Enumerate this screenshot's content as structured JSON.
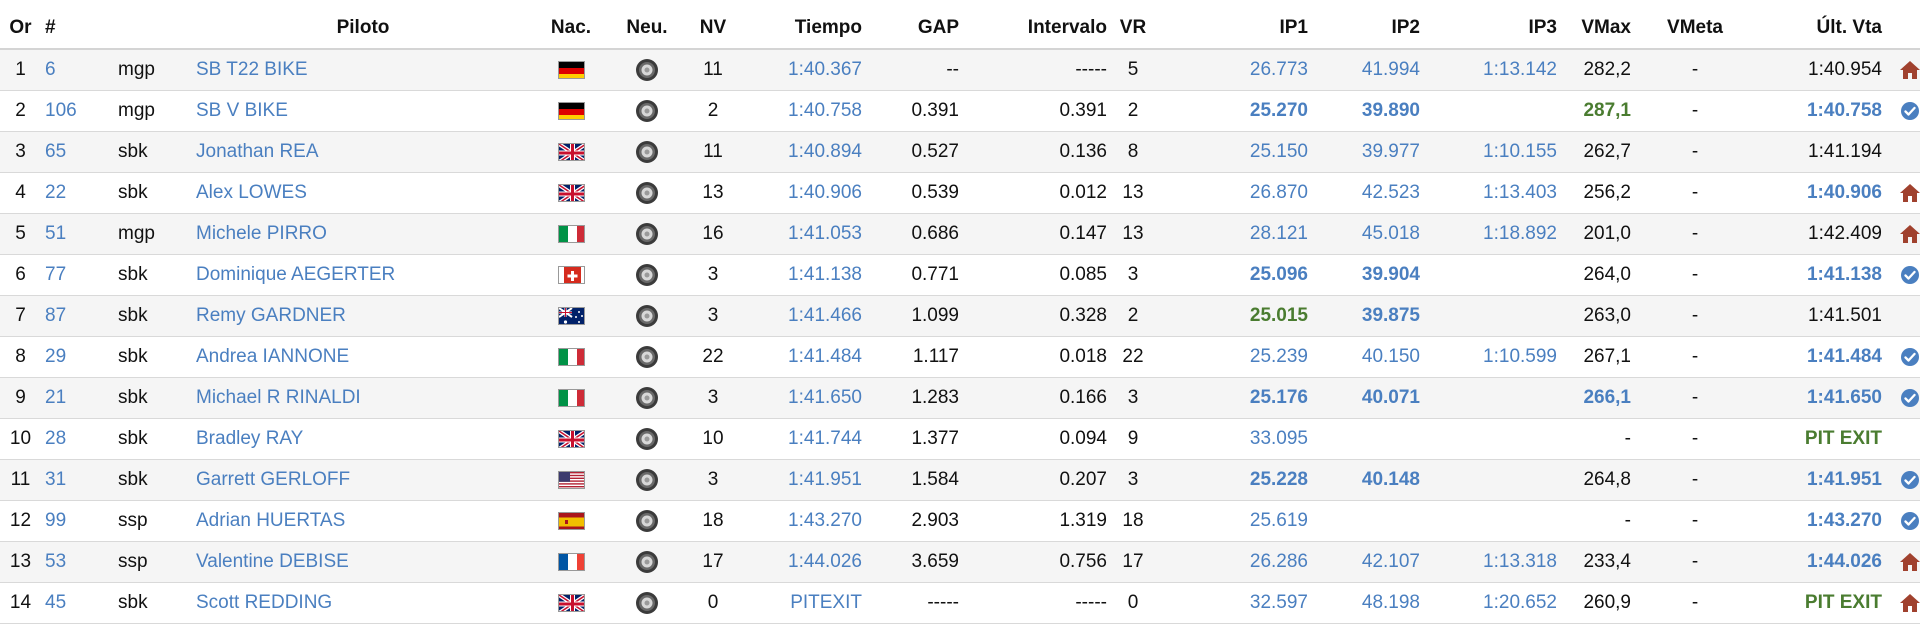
{
  "headers": {
    "or": "Or",
    "num": "#",
    "class": "",
    "pilot": "Piloto",
    "nac": "Nac.",
    "neu": "Neu.",
    "nv": "NV",
    "tiempo": "Tiempo",
    "gap": "GAP",
    "intervalo": "Intervalo",
    "vr": "VR",
    "ip1": "IP1",
    "ip2": "IP2",
    "ip3": "IP3",
    "vmax": "VMax",
    "vmeta": "VMeta",
    "ult": "Últ. Vta"
  },
  "colors": {
    "link": "#4a7fc0",
    "green": "#4a7c30",
    "home": "#a0412e",
    "check": "#4a7fc0"
  },
  "rows": [
    {
      "or": "1",
      "num": "6",
      "cls": "mgp",
      "pilot": "SB T22 BIKE",
      "flag": "de",
      "tyre": "tyre-icon",
      "nv": "11",
      "tiempo": "1:40.367",
      "gap": "--",
      "intervalo": "-----",
      "vr": "5",
      "ip1": "26.773",
      "ip2": "41.994",
      "ip3": "1:13.142",
      "vmax": "282,2",
      "vmeta": "-",
      "ult": "1:40.954",
      "status": "home-icon"
    },
    {
      "or": "2",
      "num": "106",
      "cls": "mgp",
      "pilot": "SB V BIKE",
      "flag": "de",
      "tyre": "tyre-icon",
      "nv": "2",
      "tiempo": "1:40.758",
      "gap": "0.391",
      "intervalo": "0.391",
      "vr": "2",
      "ip1": "25.270",
      "ip2": "39.890",
      "ip3": "",
      "vmax": "287,1",
      "vmeta": "-",
      "ult": "1:40.758",
      "status": "check-icon"
    },
    {
      "or": "3",
      "num": "65",
      "cls": "sbk",
      "pilot": "Jonathan REA",
      "flag": "gb",
      "tyre": "tyre-icon",
      "nv": "11",
      "tiempo": "1:40.894",
      "gap": "0.527",
      "intervalo": "0.136",
      "vr": "8",
      "ip1": "25.150",
      "ip2": "39.977",
      "ip3": "1:10.155",
      "vmax": "262,7",
      "vmeta": "-",
      "ult": "1:41.194",
      "status": ""
    },
    {
      "or": "4",
      "num": "22",
      "cls": "sbk",
      "pilot": "Alex LOWES",
      "flag": "gb",
      "tyre": "tyre-icon",
      "nv": "13",
      "tiempo": "1:40.906",
      "gap": "0.539",
      "intervalo": "0.012",
      "vr": "13",
      "ip1": "26.870",
      "ip2": "42.523",
      "ip3": "1:13.403",
      "vmax": "256,2",
      "vmeta": "-",
      "ult": "1:40.906",
      "status": "home-icon"
    },
    {
      "or": "5",
      "num": "51",
      "cls": "mgp",
      "pilot": "Michele PIRRO",
      "flag": "it",
      "tyre": "tyre-icon",
      "nv": "16",
      "tiempo": "1:41.053",
      "gap": "0.686",
      "intervalo": "0.147",
      "vr": "13",
      "ip1": "28.121",
      "ip2": "45.018",
      "ip3": "1:18.892",
      "vmax": "201,0",
      "vmeta": "-",
      "ult": "1:42.409",
      "status": "home-icon"
    },
    {
      "or": "6",
      "num": "77",
      "cls": "sbk",
      "pilot": "Dominique AEGERTER",
      "flag": "ch",
      "tyre": "tyre-icon",
      "nv": "3",
      "tiempo": "1:41.138",
      "gap": "0.771",
      "intervalo": "0.085",
      "vr": "3",
      "ip1": "25.096",
      "ip2": "39.904",
      "ip3": "",
      "vmax": "264,0",
      "vmeta": "-",
      "ult": "1:41.138",
      "status": "check-icon"
    },
    {
      "or": "7",
      "num": "87",
      "cls": "sbk",
      "pilot": "Remy GARDNER",
      "flag": "au",
      "tyre": "tyre-icon",
      "nv": "3",
      "tiempo": "1:41.466",
      "gap": "1.099",
      "intervalo": "0.328",
      "vr": "2",
      "ip1": "25.015",
      "ip2": "39.875",
      "ip3": "",
      "vmax": "263,0",
      "vmeta": "-",
      "ult": "1:41.501",
      "status": ""
    },
    {
      "or": "8",
      "num": "29",
      "cls": "sbk",
      "pilot": "Andrea IANNONE",
      "flag": "it",
      "tyre": "tyre-icon",
      "nv": "22",
      "tiempo": "1:41.484",
      "gap": "1.117",
      "intervalo": "0.018",
      "vr": "22",
      "ip1": "25.239",
      "ip2": "40.150",
      "ip3": "1:10.599",
      "vmax": "267,1",
      "vmeta": "-",
      "ult": "1:41.484",
      "status": "check-icon"
    },
    {
      "or": "9",
      "num": "21",
      "cls": "sbk",
      "pilot": "Michael R RINALDI",
      "flag": "it",
      "tyre": "tyre-icon",
      "nv": "3",
      "tiempo": "1:41.650",
      "gap": "1.283",
      "intervalo": "0.166",
      "vr": "3",
      "ip1": "25.176",
      "ip2": "40.071",
      "ip3": "",
      "vmax": "266,1",
      "vmeta": "-",
      "ult": "1:41.650",
      "status": "check-icon"
    },
    {
      "or": "10",
      "num": "28",
      "cls": "sbk",
      "pilot": "Bradley RAY",
      "flag": "gb",
      "tyre": "tyre-icon",
      "nv": "10",
      "tiempo": "1:41.744",
      "gap": "1.377",
      "intervalo": "0.094",
      "vr": "9",
      "ip1": "33.095",
      "ip2": "",
      "ip3": "",
      "vmax": "-",
      "vmeta": "-",
      "ult": "PIT EXIT",
      "status": ""
    },
    {
      "or": "11",
      "num": "31",
      "cls": "sbk",
      "pilot": "Garrett GERLOFF",
      "flag": "us",
      "tyre": "tyre-icon",
      "nv": "3",
      "tiempo": "1:41.951",
      "gap": "1.584",
      "intervalo": "0.207",
      "vr": "3",
      "ip1": "25.228",
      "ip2": "40.148",
      "ip3": "",
      "vmax": "264,8",
      "vmeta": "-",
      "ult": "1:41.951",
      "status": "check-icon"
    },
    {
      "or": "12",
      "num": "99",
      "cls": "ssp",
      "pilot": "Adrian HUERTAS",
      "flag": "es",
      "tyre": "tyre-icon",
      "nv": "18",
      "tiempo": "1:43.270",
      "gap": "2.903",
      "intervalo": "1.319",
      "vr": "18",
      "ip1": "25.619",
      "ip2": "",
      "ip3": "",
      "vmax": "-",
      "vmeta": "-",
      "ult": "1:43.270",
      "status": "check-icon"
    },
    {
      "or": "13",
      "num": "53",
      "cls": "ssp",
      "pilot": "Valentine DEBISE",
      "flag": "fr",
      "tyre": "tyre-icon",
      "nv": "17",
      "tiempo": "1:44.026",
      "gap": "3.659",
      "intervalo": "0.756",
      "vr": "17",
      "ip1": "26.286",
      "ip2": "42.107",
      "ip3": "1:13.318",
      "vmax": "233,4",
      "vmeta": "-",
      "ult": "1:44.026",
      "status": "home-icon"
    },
    {
      "or": "14",
      "num": "45",
      "cls": "sbk",
      "pilot": "Scott REDDING",
      "flag": "gb",
      "tyre": "tyre-icon",
      "nv": "0",
      "tiempo": "PITEXIT",
      "gap": "-----",
      "intervalo": "-----",
      "vr": "0",
      "ip1": "32.597",
      "ip2": "48.198",
      "ip3": "1:20.652",
      "vmax": "260,9",
      "vmeta": "-",
      "ult": "PIT EXIT",
      "status": "home-icon"
    }
  ]
}
